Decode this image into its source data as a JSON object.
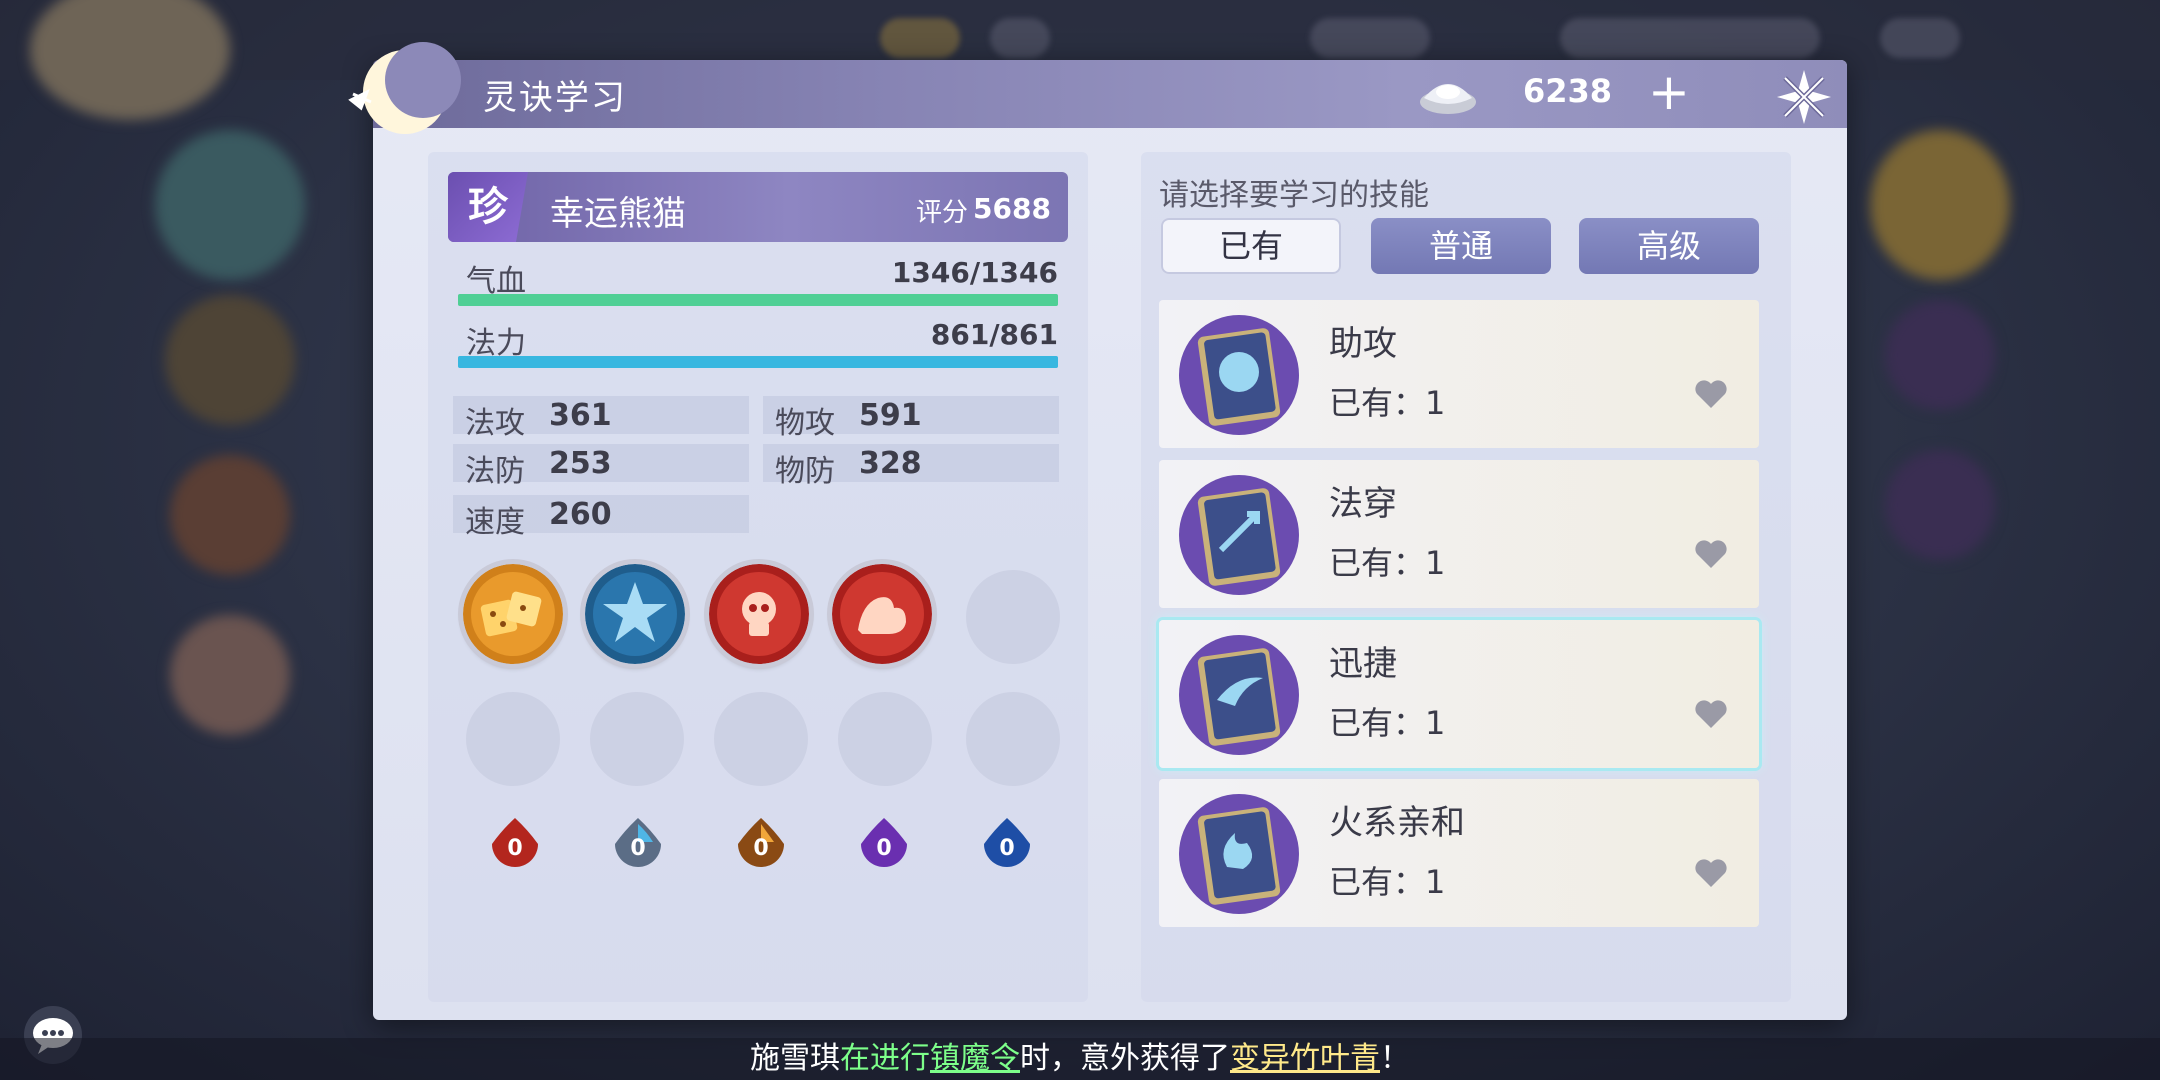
{
  "window": {
    "title": "灵诀学习",
    "currency_value": "6238"
  },
  "pet": {
    "rarity": "珍",
    "name": "幸运熊猫",
    "score_label": "评分",
    "score_value": "5688",
    "hp": {
      "label": "气血",
      "value": "1346/1346",
      "fill": 1.0,
      "color": "#4fcf95"
    },
    "mp": {
      "label": "法力",
      "value": "861/861",
      "fill": 1.0,
      "color": "#38b7e0"
    },
    "attributes": [
      {
        "label": "法攻",
        "value": "361"
      },
      {
        "label": "物攻",
        "value": "591"
      },
      {
        "label": "法防",
        "value": "253"
      },
      {
        "label": "物防",
        "value": "328"
      },
      {
        "label": "速度",
        "value": "260"
      }
    ],
    "runes": [
      {
        "count": "0",
        "color": "#b3261e"
      },
      {
        "count": "0",
        "color": "#5b6d86"
      },
      {
        "count": "0",
        "color": "#8a4a14"
      },
      {
        "count": "0",
        "color": "#6a2fb0"
      },
      {
        "count": "0",
        "color": "#1e4ea6"
      }
    ]
  },
  "learn": {
    "prompt": "请选择要学习的技能",
    "tabs": [
      "已有",
      "普通",
      "高级"
    ],
    "active_tab": 0,
    "skills": [
      {
        "name": "助攻",
        "owned": "已有：1"
      },
      {
        "name": "法穿",
        "owned": "已有：1"
      },
      {
        "name": "迅捷",
        "owned": "已有：1"
      },
      {
        "name": "火系亲和",
        "owned": "已有：1"
      }
    ],
    "selected_skill": 2
  },
  "broadcast": {
    "p1": "施雪琪",
    "p2": "在进行",
    "p3": "镇魔令",
    "p4": "时，意外获得了",
    "p5": "变异竹叶青",
    "p6": "！"
  }
}
